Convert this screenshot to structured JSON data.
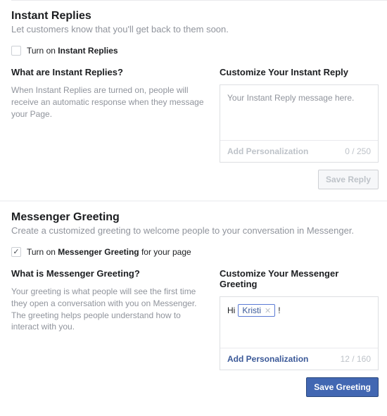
{
  "instantReplies": {
    "title": "Instant Replies",
    "subtitle": "Let customers know that you'll get back to them soon.",
    "toggle": {
      "prefix": "Turn on ",
      "bold": "Instant Replies",
      "checked": false
    },
    "left": {
      "title": "What are Instant Replies?",
      "desc": "When Instant Replies are turned on, people will receive an automatic response when they message your Page."
    },
    "right": {
      "title": "Customize Your Instant Reply",
      "placeholder": "Your Instant Reply message here.",
      "addPersonalization": "Add Personalization",
      "counter": "0 / 250",
      "saveBtn": "Save Reply"
    }
  },
  "messengerGreeting": {
    "title": "Messenger Greeting",
    "subtitle": "Create a customized greeting to welcome people to your conversation in Messenger.",
    "toggle": {
      "prefix": "Turn on ",
      "bold": "Messenger Greeting",
      "suffix": " for your page",
      "checked": true
    },
    "left": {
      "title": "What is Messenger Greeting?",
      "desc": "Your greeting is what people will see the first time they open a conversation with you on Messenger. The greeting helps people understand how to interact with you."
    },
    "right": {
      "title": "Customize Your Messenger Greeting",
      "greetingPrefix": "Hi",
      "tagName": "Kristi",
      "greetingSuffix": "!",
      "addPersonalization": "Add Personalization",
      "counter": "12 / 160",
      "saveBtn": "Save Greeting"
    }
  }
}
